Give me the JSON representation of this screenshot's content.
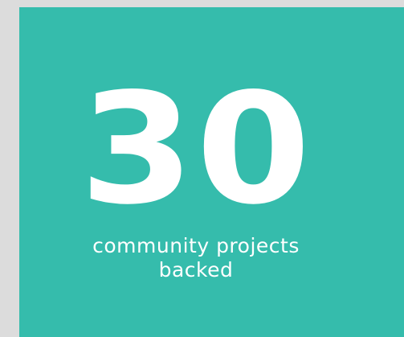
{
  "stat": {
    "number": "30",
    "label_line1": "community projects",
    "label_line2": "backed"
  },
  "colors": {
    "background": "#dcdcdc",
    "card": "#35bcac",
    "text": "#ffffff"
  }
}
